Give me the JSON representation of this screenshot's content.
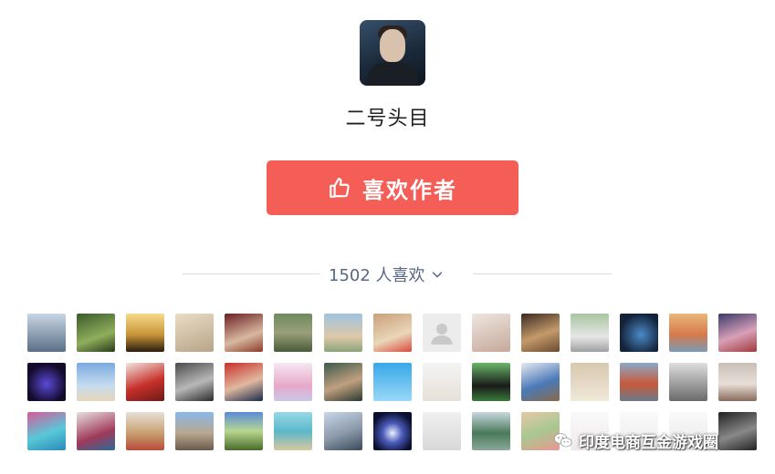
{
  "author": {
    "name": "二号头目"
  },
  "like_button": {
    "label": "喜欢作者",
    "icon": "thumbs-up-icon",
    "color": "#f55d57"
  },
  "likers": {
    "count_text": "1502 人喜欢",
    "icon": "chevron-down-icon",
    "color": "#586784"
  },
  "avatars": [
    {
      "bg": "linear-gradient(180deg,#c8d6e4,#5a6f86)"
    },
    {
      "bg": "linear-gradient(160deg,#3c5a2a,#8fae5c 60%,#2a3a1a)"
    },
    {
      "bg": "linear-gradient(180deg,#f7d98a,#c89438 55%,#2a1c10)"
    },
    {
      "bg": "linear-gradient(160deg,#e9ddc6,#b7a488)"
    },
    {
      "bg": "linear-gradient(160deg,#6b1f22,#d8b8a0 60%,#8a3a2a)"
    },
    {
      "bg": "linear-gradient(180deg,#6f8a5c,#9aa07a 50%,#4a5a3a)"
    },
    {
      "bg": "linear-gradient(180deg,#9fc3e0,#e0c8a8 60%,#8aa47c)"
    },
    {
      "bg": "linear-gradient(160deg,#caa07a,#e9d6b8 60%,#d84a3a)"
    },
    {
      "bg": "#ececec"
    },
    {
      "bg": "linear-gradient(160deg,#efe6e0,#c5a79a)"
    },
    {
      "bg": "linear-gradient(160deg,#3a2a22,#c49a6a 55%,#6a4a32)"
    },
    {
      "bg": "linear-gradient(180deg,#a9c5a0,#e6e6e6 60%,#a0a0a0)"
    },
    {
      "bg": "radial-gradient(circle at 55% 55%,#4a8ac8,#14233a 70%)"
    },
    {
      "bg": "linear-gradient(180deg,#e9b87a,#d67a4a 55%,#7a9ab8)"
    },
    {
      "bg": "linear-gradient(160deg,#3a3a6a,#d8a0b8 55%,#a03a3a)"
    },
    {
      "bg": "radial-gradient(circle at 50% 55%,#5a4ad8,#140a2a 70%)"
    },
    {
      "bg": "linear-gradient(180deg,#7aaae0,#c6dcef 60%,#e6d6b8)"
    },
    {
      "bg": "linear-gradient(160deg,#f0e6e0,#c8302a 55%,#6a1a1a)"
    },
    {
      "bg": "linear-gradient(160deg,#4a4a4a,#b8b8b8 55%,#2a2a2a)"
    },
    {
      "bg": "linear-gradient(160deg,#c8302a,#e0b8a0 55%,#1a2a4a)"
    },
    {
      "bg": "linear-gradient(180deg,#f6e8f2,#e8a8c8 60%,#c8c8e8)"
    },
    {
      "bg": "linear-gradient(160deg,#3a5a4a,#c0a080 55%,#2a3a30)"
    },
    {
      "bg": "linear-gradient(180deg,#38a8e8,#9ad8f8)"
    },
    {
      "bg": "linear-gradient(180deg,#f4f4f4,#e6e0d8)"
    },
    {
      "bg": "linear-gradient(180deg,#6ab86a,#1a1a1a 60%,#3a7a3a)"
    },
    {
      "bg": "linear-gradient(160deg,#e8e8f0,#4a7ab8 55%,#8a6a4a)"
    },
    {
      "bg": "linear-gradient(180deg,#d8c8b0,#f0e8d8)"
    },
    {
      "bg": "linear-gradient(180deg,#8aa8c8,#c85a3a 55%,#6a7a8a)"
    },
    {
      "bg": "linear-gradient(180deg,#dedede,#6a6a6a)"
    },
    {
      "bg": "linear-gradient(180deg,#c8c0b8,#e8e0d8 55%,#8a6a5a)"
    },
    {
      "bg": "linear-gradient(160deg,#d85a9a,#58c8d8 55%,#2a8ab8)"
    },
    {
      "bg": "linear-gradient(160deg,#e8e0e0,#a03a5a 60%,#2a6a9a)"
    },
    {
      "bg": "linear-gradient(180deg,#e8e0d8,#c8a070 55%,#b84a3a)"
    },
    {
      "bg": "linear-gradient(180deg,#8ab8e8,#b8a890 55%,#6a5a4a)"
    },
    {
      "bg": "linear-gradient(180deg,#5a8ad8,#b8d890 50%,#4a6a2a)"
    },
    {
      "bg": "linear-gradient(180deg,#9ad8e8,#5ab8c8 50%,#d8c8a0)"
    },
    {
      "bg": "linear-gradient(160deg,#c8d8e8,#8a98a8 55%,#3a4a5a)"
    },
    {
      "bg": "radial-gradient(circle at 50% 55%,#e8f0ff,#4a5ab8 35%,#0a1030 75%)"
    },
    {
      "bg": "linear-gradient(180deg,#f0f0f0,#d8d8d8)"
    },
    {
      "bg": "linear-gradient(180deg,#c8d8e0,#4a7a5a 55%,#8aa89a)"
    },
    {
      "bg": "linear-gradient(160deg,#e8c8a8,#a8c890 50%,#e89890)"
    },
    {
      "bg": "linear-gradient(180deg,#fafafa,#f0e8ec)"
    },
    {
      "bg": "linear-gradient(180deg,#fafafa,#ececec)"
    },
    {
      "bg": "linear-gradient(180deg,#fafafa,#e8e8e8)"
    },
    {
      "bg": "linear-gradient(160deg,#222,#888 55%,#222)"
    }
  ],
  "watermark": {
    "text": "印度电商互金游戏圈",
    "icon": "wechat-icon"
  }
}
